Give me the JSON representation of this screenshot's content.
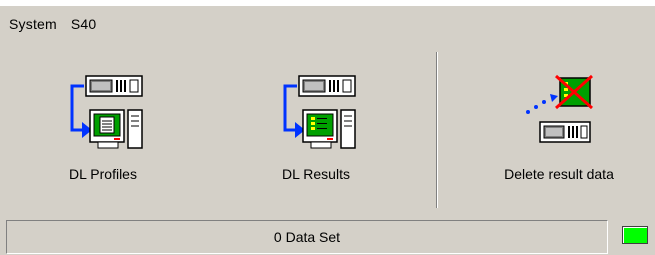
{
  "header": {
    "section": "System",
    "device": "S40"
  },
  "actions": [
    {
      "label": "DL Profiles",
      "icon": "download-profiles-icon"
    },
    {
      "label": "DL Results",
      "icon": "download-results-icon"
    },
    {
      "label": "Delete result data",
      "icon": "delete-results-icon"
    }
  ],
  "status": {
    "text": "0 Data Set",
    "indicator_color": "#00ff00"
  }
}
